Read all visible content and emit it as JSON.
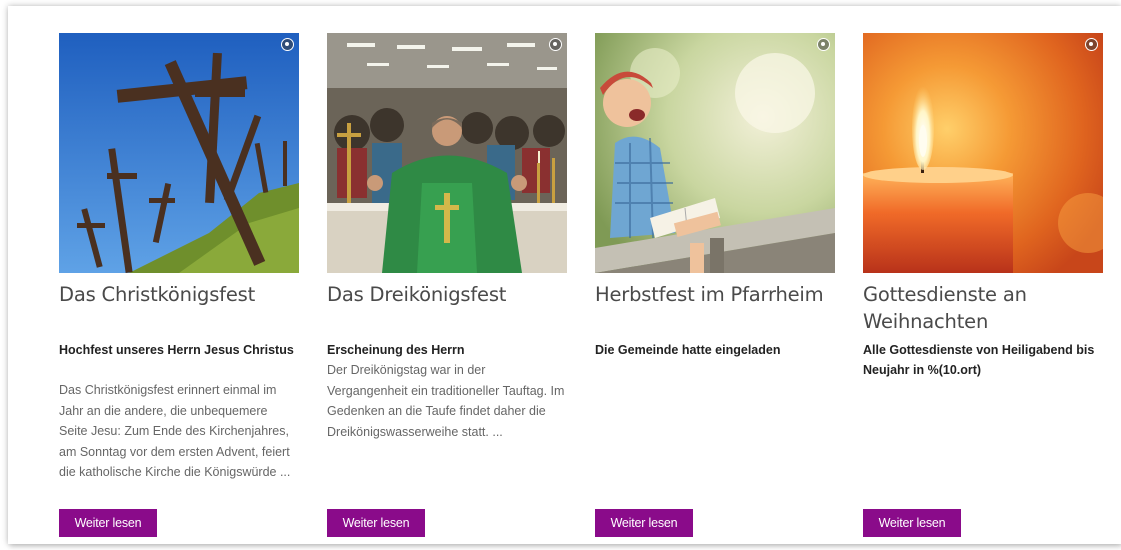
{
  "cards": [
    {
      "image": "christ-the-king-crosses",
      "title": "Das Christkönigsfest",
      "subtitle": "Hochfest unseres Herrn Jesus Christus",
      "text": "Das Christkönigsfest erinnert einmal im Jahr an die andere, die unbequemere Seite Jesu: Zum Ende des Kirchenjahres, am Sonntag vor dem ersten Advent, feiert die katholische Kirche die Königswürde ...",
      "button": "Weiter lesen"
    },
    {
      "image": "priest-at-altar",
      "title": "Das Dreikönigsfest",
      "subtitle": "Erscheinung des Herrn",
      "text": "Der Dreikönigstag war in der Vergangenheit ein traditioneller Tauftag. Im Gedenken an die Taufe findet daher die Dreikönigswasserweihe statt. ...",
      "button": "Weiter lesen"
    },
    {
      "image": "laughing-child-with-book",
      "title": "Herbstfest im Pfarrheim",
      "subtitle": "Die Gemeinde hatte eingeladen",
      "text": "",
      "button": "Weiter lesen"
    },
    {
      "image": "burning-candle",
      "title": "Gottesdienste an Weihnachten",
      "subtitle": "Alle Gottesdienste von Heiligabend bis Neujahr in %(10.ort)",
      "text": "",
      "button": "Weiter lesen"
    }
  ],
  "colors": {
    "button_background": "#8a0b8a",
    "button_text": "#ffffff",
    "title_text": "#4a4a4a",
    "body_text": "#666666"
  },
  "icons": [
    "image-info-icon"
  ]
}
